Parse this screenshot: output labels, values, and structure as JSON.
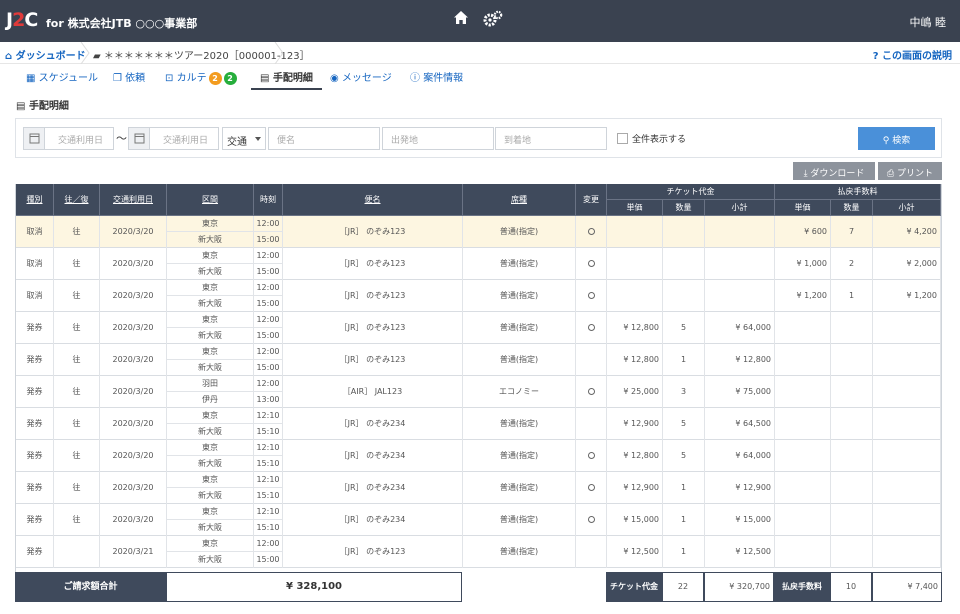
{
  "app": {
    "logo_main": "J",
    "logo_accent": "2",
    "logo_end": "C",
    "company": "for 株式会社JTB ○○○事業部",
    "user": "中嶋 睦"
  },
  "icons": {
    "home": "home-icon",
    "settings": "gears-icon"
  },
  "breadcrumb": {
    "dashboard": "ダッシュボード",
    "project": "＊＊＊＊＊＊＊ツアー2020［000001-123］"
  },
  "help": "この画面の説明",
  "tabs": [
    {
      "label": "スケジュール"
    },
    {
      "label": "依頼"
    },
    {
      "label": "カルテ",
      "badges": [
        "2",
        "2"
      ]
    },
    {
      "label": "手配明細"
    },
    {
      "label": "メッセージ"
    },
    {
      "label": "案件情報"
    }
  ],
  "section_title": "手配明細",
  "filter": {
    "date_from_ph": "交通利用日",
    "date_to_ph": "交通利用日",
    "tilde": "〜",
    "type_value": "交通",
    "train_ph": "便名",
    "from_ph": "出発地",
    "to_ph": "到着地",
    "show_all": "全件表示する",
    "search": "検索"
  },
  "actions": {
    "download": "ダウンロード",
    "print": "プリント"
  },
  "headers": {
    "type": "種別",
    "direction": "往／復",
    "date": "交通利用日",
    "section": "区間",
    "time": "時刻",
    "flight": "便名",
    "seat": "席種",
    "change": "変更",
    "ticket_group": "チケット代金",
    "refund_group": "払戻手数料",
    "unit": "単価",
    "qty": "数量",
    "subtotal": "小計"
  },
  "rows": [
    {
      "type": "取消",
      "dir": "往",
      "date": "2020/3/20",
      "from": "東京",
      "to": "新大阪",
      "t1": "12:00",
      "t2": "15:00",
      "flight": "［JR］ のぞみ123",
      "seat": "普通(指定)",
      "change": true,
      "tu": "",
      "tq": "",
      "ts": "",
      "ru": "¥ 600",
      "rq": "7",
      "rs": "¥ 4,200",
      "hl": true
    },
    {
      "type": "取消",
      "dir": "往",
      "date": "2020/3/20",
      "from": "東京",
      "to": "新大阪",
      "t1": "12:00",
      "t2": "15:00",
      "flight": "［JR］ のぞみ123",
      "seat": "普通(指定)",
      "change": true,
      "tu": "",
      "tq": "",
      "ts": "",
      "ru": "¥ 1,000",
      "rq": "2",
      "rs": "¥ 2,000"
    },
    {
      "type": "取消",
      "dir": "往",
      "date": "2020/3/20",
      "from": "東京",
      "to": "新大阪",
      "t1": "12:00",
      "t2": "15:00",
      "flight": "［JR］ のぞみ123",
      "seat": "普通(指定)",
      "change": true,
      "tu": "",
      "tq": "",
      "ts": "",
      "ru": "¥ 1,200",
      "rq": "1",
      "rs": "¥ 1,200"
    },
    {
      "type": "発券",
      "dir": "往",
      "date": "2020/3/20",
      "from": "東京",
      "to": "新大阪",
      "t1": "12:00",
      "t2": "15:00",
      "flight": "［JR］ のぞみ123",
      "seat": "普通(指定)",
      "change": true,
      "tu": "¥ 12,800",
      "tq": "5",
      "ts": "¥ 64,000",
      "ru": "",
      "rq": "",
      "rs": ""
    },
    {
      "type": "発券",
      "dir": "往",
      "date": "2020/3/20",
      "from": "東京",
      "to": "新大阪",
      "t1": "12:00",
      "t2": "15:00",
      "flight": "［JR］ のぞみ123",
      "seat": "普通(指定)",
      "change": false,
      "tu": "¥ 12,800",
      "tq": "1",
      "ts": "¥ 12,800",
      "ru": "",
      "rq": "",
      "rs": ""
    },
    {
      "type": "発券",
      "dir": "往",
      "date": "2020/3/20",
      "from": "羽田",
      "to": "伊丹",
      "t1": "12:00",
      "t2": "13:00",
      "flight": "［AIR］ JAL123",
      "seat": "エコノミー",
      "change": true,
      "tu": "¥ 25,000",
      "tq": "3",
      "ts": "¥ 75,000",
      "ru": "",
      "rq": "",
      "rs": ""
    },
    {
      "type": "発券",
      "dir": "往",
      "date": "2020/3/20",
      "from": "東京",
      "to": "新大阪",
      "t1": "12:10",
      "t2": "15:10",
      "flight": "［JR］ のぞみ234",
      "seat": "普通(指定)",
      "change": false,
      "tu": "¥ 12,900",
      "tq": "5",
      "ts": "¥ 64,500",
      "ru": "",
      "rq": "",
      "rs": ""
    },
    {
      "type": "発券",
      "dir": "往",
      "date": "2020/3/20",
      "from": "東京",
      "to": "新大阪",
      "t1": "12:10",
      "t2": "15:10",
      "flight": "［JR］ のぞみ234",
      "seat": "普通(指定)",
      "change": true,
      "tu": "¥ 12,800",
      "tq": "5",
      "ts": "¥ 64,000",
      "ru": "",
      "rq": "",
      "rs": ""
    },
    {
      "type": "発券",
      "dir": "往",
      "date": "2020/3/20",
      "from": "東京",
      "to": "新大阪",
      "t1": "12:10",
      "t2": "15:10",
      "flight": "［JR］ のぞみ234",
      "seat": "普通(指定)",
      "change": true,
      "tu": "¥ 12,900",
      "tq": "1",
      "ts": "¥ 12,900",
      "ru": "",
      "rq": "",
      "rs": ""
    },
    {
      "type": "発券",
      "dir": "往",
      "date": "2020/3/20",
      "from": "東京",
      "to": "新大阪",
      "t1": "12:10",
      "t2": "15:10",
      "flight": "［JR］ のぞみ234",
      "seat": "普通(指定)",
      "change": true,
      "tu": "¥ 15,000",
      "tq": "1",
      "ts": "¥ 15,000",
      "ru": "",
      "rq": "",
      "rs": ""
    },
    {
      "type": "発券",
      "dir": "",
      "date": "2020/3/21",
      "from": "東京",
      "to": "新大阪",
      "t1": "12:00",
      "t2": "15:00",
      "flight": "［JR］ のぞみ123",
      "seat": "普通(指定)",
      "change": false,
      "tu": "¥ 12,500",
      "tq": "1",
      "ts": "¥ 12,500",
      "ru": "",
      "rq": "",
      "rs": ""
    }
  ],
  "footer": {
    "total_label": "ご請求額合計",
    "total": "¥ 328,100",
    "ticket_label": "チケット代金",
    "ticket_qty": "22",
    "ticket_total": "¥ 320,700",
    "refund_label": "払戻手数料",
    "refund_qty": "10",
    "refund_total": "¥ 7,400"
  }
}
